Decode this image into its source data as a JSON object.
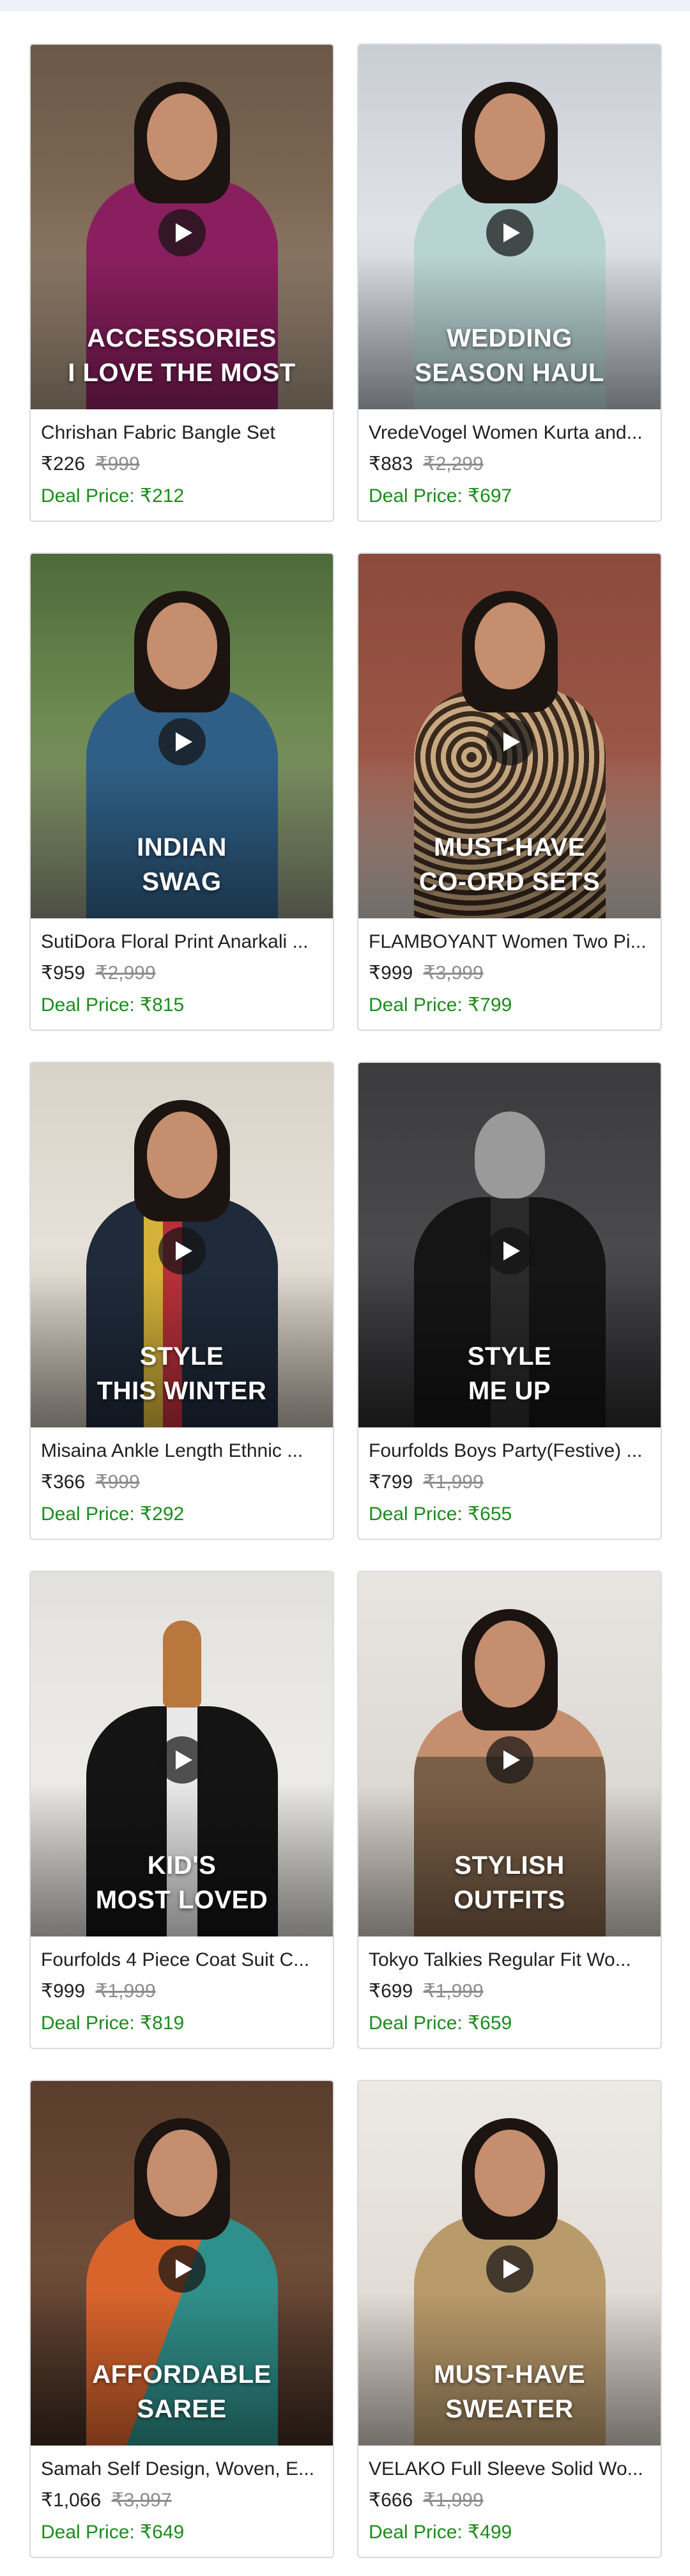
{
  "products": [
    {
      "overlay": "ACCESSORIES\nI LOVE THE MOST",
      "name": "Chrishan Fabric Bangle Set",
      "price": "₹226",
      "mrp": "₹999",
      "deal": "Deal Price: ₹212"
    },
    {
      "overlay": "WEDDING\nSEASON HAUL",
      "name": "VredeVogel Women Kurta and...",
      "price": "₹883",
      "mrp": "₹2,299",
      "deal": "Deal Price: ₹697"
    },
    {
      "overlay": "INDIAN\nSWAG",
      "name": "SutiDora Floral Print Anarkali ...",
      "price": "₹959",
      "mrp": "₹2,999",
      "deal": "Deal Price: ₹815"
    },
    {
      "overlay": "MUST-HAVE\nCO-ORD SETS",
      "name": "FLAMBOYANT Women Two Pi...",
      "price": "₹999",
      "mrp": "₹3,999",
      "deal": "Deal Price: ₹799"
    },
    {
      "overlay": "STYLE\nTHIS WINTER",
      "name": "Misaina Ankle Length  Ethnic ...",
      "price": "₹366",
      "mrp": "₹999",
      "deal": "Deal Price: ₹292"
    },
    {
      "overlay": "STYLE\nME UP",
      "name": "Fourfolds Boys Party(Festive) ...",
      "price": "₹799",
      "mrp": "₹1,999",
      "deal": "Deal Price: ₹655"
    },
    {
      "overlay": "KID'S\nMOST LOVED",
      "name": "Fourfolds 4 Piece Coat Suit C...",
      "price": "₹999",
      "mrp": "₹1,999",
      "deal": "Deal Price: ₹819"
    },
    {
      "overlay": "STYLISH\nOUTFITS",
      "name": "Tokyo Talkies Regular Fit Wo...",
      "price": "₹699",
      "mrp": "₹1,999",
      "deal": "Deal Price: ₹659"
    },
    {
      "overlay": "AFFORDABLE\nSAREE",
      "name": "Samah Self Design, Woven, E...",
      "price": "₹1,066",
      "mrp": "₹3,997",
      "deal": "Deal Price: ₹649"
    },
    {
      "overlay": "MUST-HAVE\nSWEATER",
      "name": "VELAKO Full Sleeve Solid Wo...",
      "price": "₹666",
      "mrp": "₹1,999",
      "deal": "Deal Price: ₹499"
    }
  ],
  "colors": {
    "deal_green": "#1c8c1c",
    "mrp_gray": "#8c8c8c",
    "card_border": "#d9dbe0"
  },
  "icons": {
    "play": "play-icon"
  }
}
